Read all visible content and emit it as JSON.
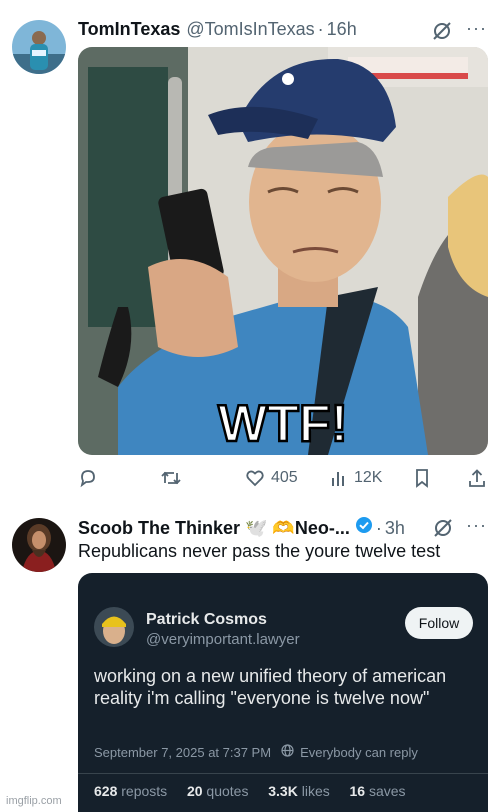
{
  "tweet1": {
    "display_name": "TomInTexas",
    "handle": "@TomIsInTexas",
    "separator": "·",
    "time": "16h",
    "media_overlay_text": "WTF!",
    "actions": {
      "reply_icon": "reply-icon",
      "retweet_icon": "retweet-icon",
      "like_count": "405",
      "views_count": "12K",
      "bookmark_icon": "bookmark-icon",
      "share_icon": "share-icon"
    }
  },
  "tweet2": {
    "display_name": "Scoob The Thinker 🕊️ 🫶Neo-...",
    "separator": "·",
    "time": "3h",
    "text": "Republicans never pass the youre twelve test",
    "quote": {
      "name": "Patrick Cosmos",
      "handle": "@veryimportant.lawyer",
      "follow_label": "Follow",
      "text": "working on a new unified theory of american reality i'm calling \"everyone is twelve now\"",
      "timestamp": "September 7, 2025 at 7:37 PM",
      "audience": "Everybody can reply",
      "reposts_count": "628",
      "reposts_label": "reposts",
      "quotes_count": "20",
      "quotes_label": "quotes",
      "likes_count": "3.3K",
      "likes_label": "likes",
      "saves_count": "16",
      "saves_label": "saves"
    }
  },
  "watermark": "imgflip.com",
  "colors": {
    "text_primary": "#0f1419",
    "text_secondary": "#536471",
    "verified": "#1d9bf0",
    "quote_bg": "#15202b"
  }
}
